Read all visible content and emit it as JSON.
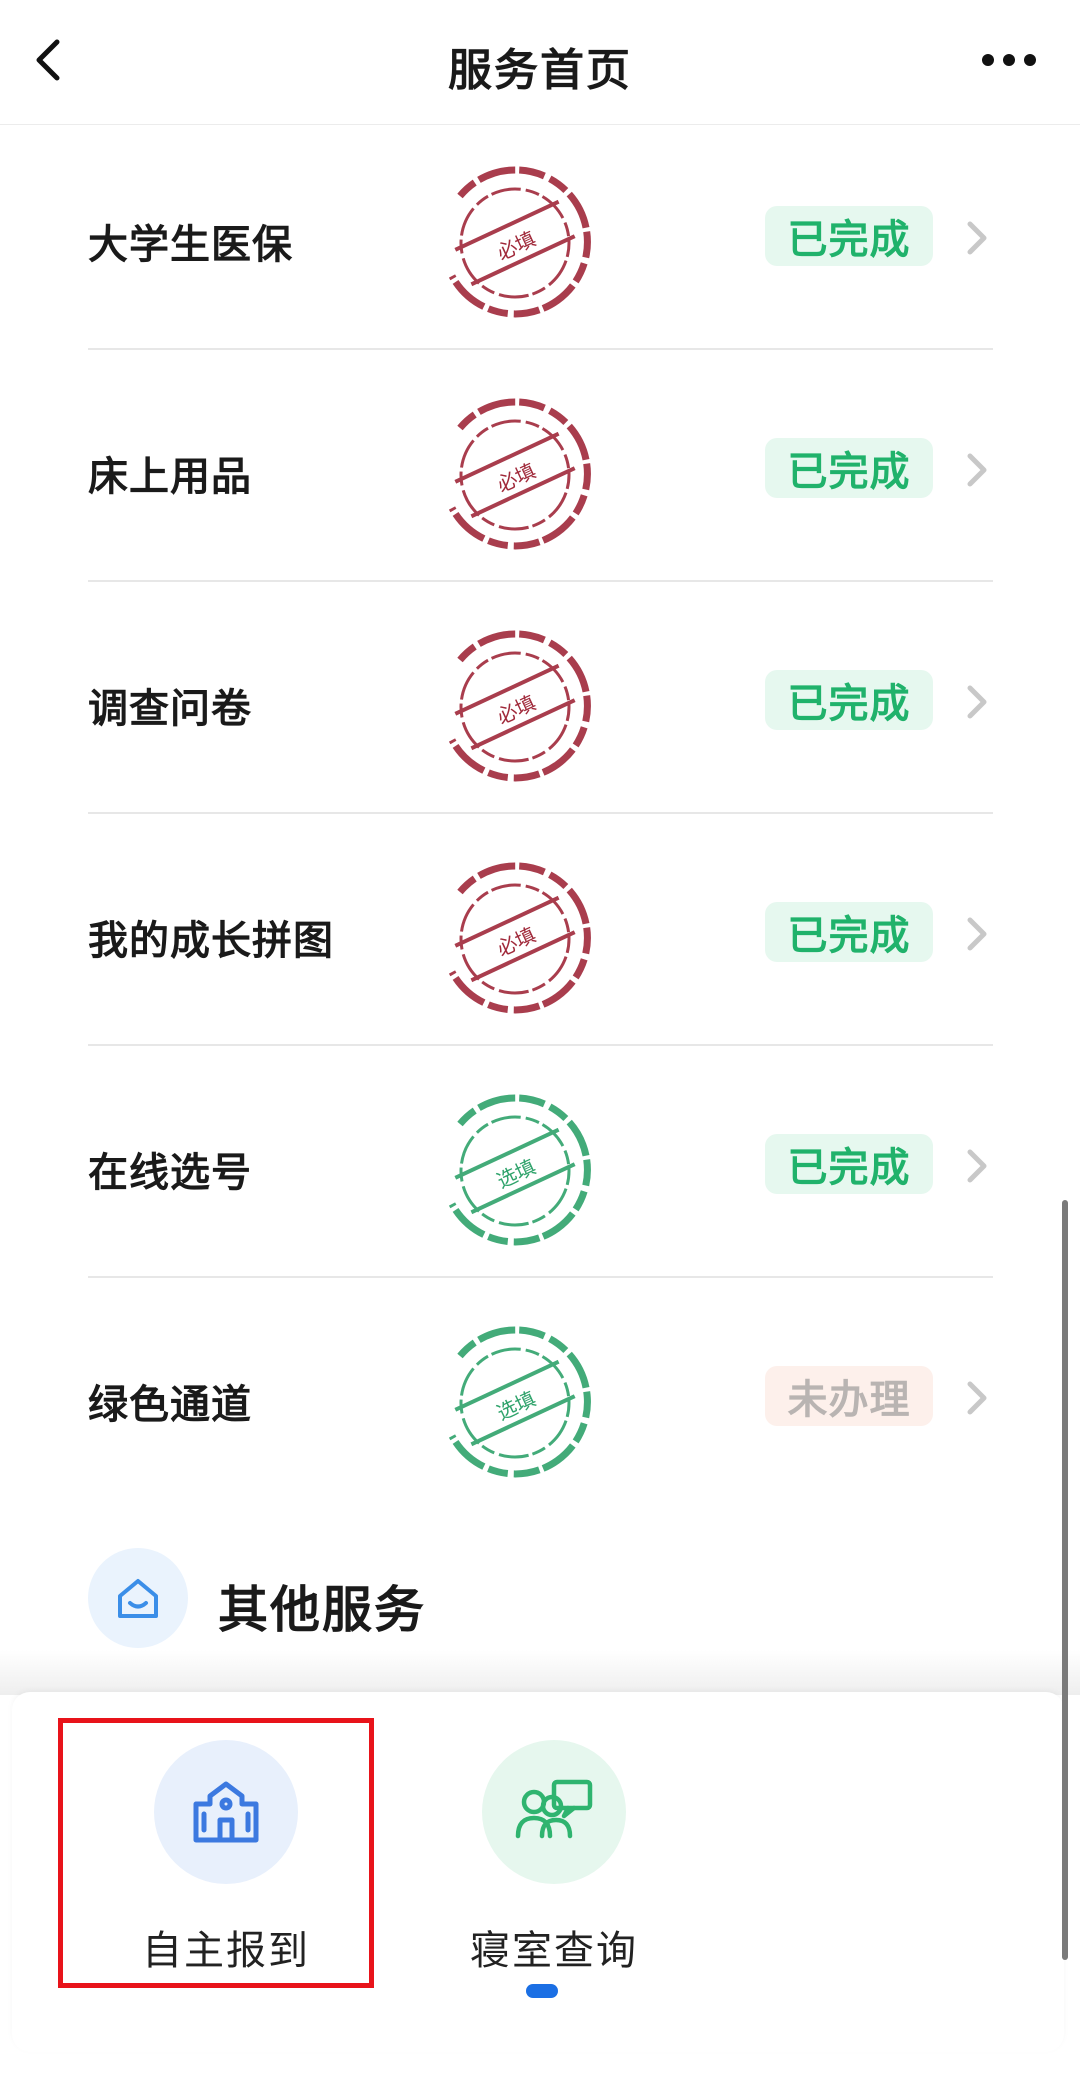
{
  "header": {
    "title": "服务首页",
    "back_icon": "chevron-left-icon",
    "more_icon": "more-horizontal-icon"
  },
  "tasks": [
    {
      "label": "大学生医保",
      "stamp": "必填",
      "stamp_color": "#a0293a",
      "status": "已完成",
      "status_type": "done"
    },
    {
      "label": "床上用品",
      "stamp": "必填",
      "stamp_color": "#a0293a",
      "status": "已完成",
      "status_type": "done"
    },
    {
      "label": "调查问卷",
      "stamp": "必填",
      "stamp_color": "#a0293a",
      "status": "已完成",
      "status_type": "done"
    },
    {
      "label": "我的成长拼图",
      "stamp": "必填",
      "stamp_color": "#a0293a",
      "status": "已完成",
      "status_type": "done"
    },
    {
      "label": "在线选号",
      "stamp": "选填",
      "stamp_color": "#2fa36b",
      "status": "已完成",
      "status_type": "done"
    },
    {
      "label": "绿色通道",
      "stamp": "选填",
      "stamp_color": "#2fa36b",
      "status": "未办理",
      "status_type": "pending"
    }
  ],
  "other_services": {
    "title": "其他服务",
    "icon": "home-icon",
    "items": [
      {
        "label": "自主报到",
        "icon": "school-building-icon",
        "bg": "#e8f0fc",
        "color": "#3c79e0"
      },
      {
        "label": "寝室查询",
        "icon": "group-chat-icon",
        "bg": "#e6f7ee",
        "color": "#2fb46f"
      }
    ]
  },
  "colors": {
    "done_text": "#20b26b",
    "done_bg": "#e6f8ef",
    "pending_text": "#b9b4b2",
    "pending_bg": "#fdf0eb",
    "highlight": "#e8131a",
    "accent": "#1b6fe4"
  }
}
